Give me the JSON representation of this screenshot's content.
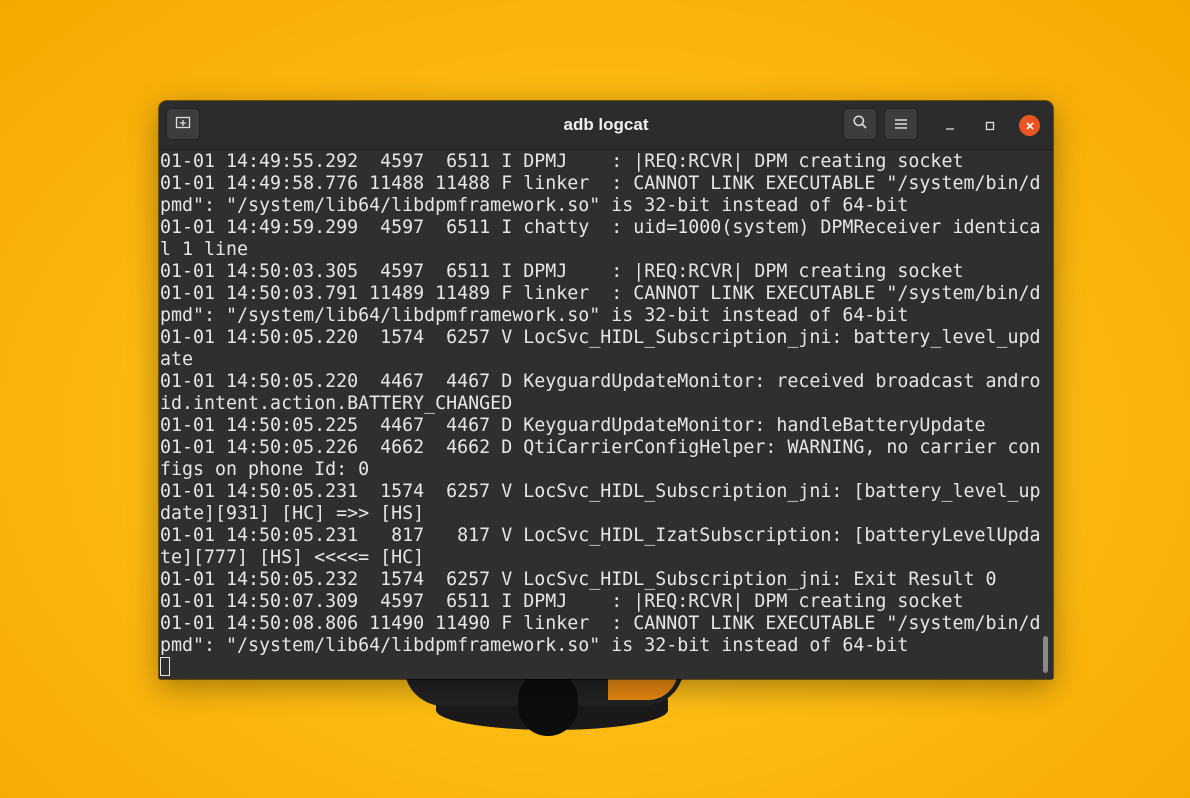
{
  "window": {
    "title": "adb logcat",
    "icons": {
      "new_tab": "new-tab-icon",
      "search": "search-icon",
      "menu": "hamburger-menu-icon",
      "minimize": "minimize-icon",
      "maximize": "maximize-icon",
      "close": "close-icon"
    },
    "close_color": "#e95420"
  },
  "terminal": {
    "lines": [
      "01-01 14:49:55.292  4597  6511 I DPMJ    : |REQ:RCVR| DPM creating socket",
      "01-01 14:49:58.776 11488 11488 F linker  : CANNOT LINK EXECUTABLE \"/system/bin/d",
      "pmd\": \"/system/lib64/libdpmframework.so\" is 32-bit instead of 64-bit",
      "01-01 14:49:59.299  4597  6511 I chatty  : uid=1000(system) DPMReceiver identica",
      "l 1 line",
      "01-01 14:50:03.305  4597  6511 I DPMJ    : |REQ:RCVR| DPM creating socket",
      "01-01 14:50:03.791 11489 11489 F linker  : CANNOT LINK EXECUTABLE \"/system/bin/d",
      "pmd\": \"/system/lib64/libdpmframework.so\" is 32-bit instead of 64-bit",
      "01-01 14:50:05.220  1574  6257 V LocSvc_HIDL_Subscription_jni: battery_level_upd",
      "ate",
      "01-01 14:50:05.220  4467  4467 D KeyguardUpdateMonitor: received broadcast andro",
      "id.intent.action.BATTERY_CHANGED",
      "01-01 14:50:05.225  4467  4467 D KeyguardUpdateMonitor: handleBatteryUpdate",
      "01-01 14:50:05.226  4662  4662 D QtiCarrierConfigHelper: WARNING, no carrier con",
      "figs on phone Id: 0",
      "01-01 14:50:05.231  1574  6257 V LocSvc_HIDL_Subscription_jni: [battery_level_up",
      "date][931] [HC] =>> [HS]",
      "01-01 14:50:05.231   817   817 V LocSvc_HIDL_IzatSubscription: [batteryLevelUpda",
      "te][777] [HS] <<<<= [HC]",
      "01-01 14:50:05.232  1574  6257 V LocSvc_HIDL_Subscription_jni: Exit Result 0",
      "01-01 14:50:07.309  4597  6511 I DPMJ    : |REQ:RCVR| DPM creating socket",
      "01-01 14:50:08.806 11490 11490 F linker  : CANNOT LINK EXECUTABLE \"/system/bin/d",
      "pmd\": \"/system/lib64/libdpmframework.so\" is 32-bit instead of 64-bit"
    ]
  }
}
